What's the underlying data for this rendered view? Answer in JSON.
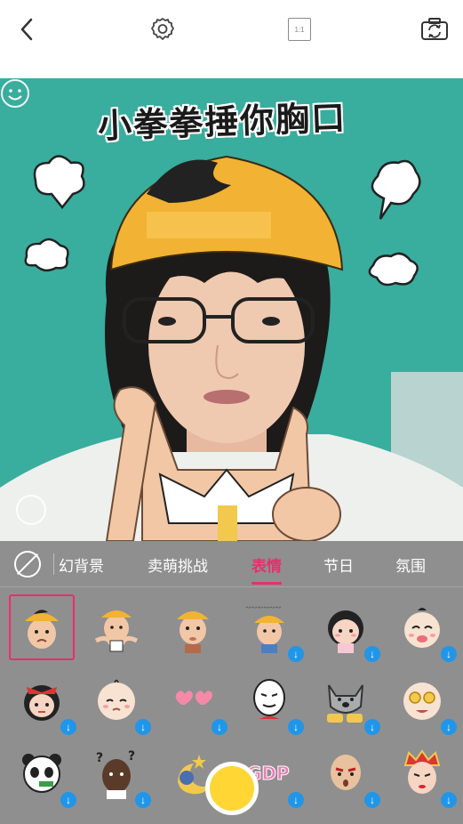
{
  "topbar": {
    "back_icon": "chevron-left-icon",
    "settings_icon": "gear-icon",
    "ratio_label": "1:1",
    "switch_icon": "camera-switch-icon"
  },
  "preview": {
    "caption": "小拳拳捶你胸口"
  },
  "tabs": [
    {
      "label": "幻背景"
    },
    {
      "label": "卖萌挑战"
    },
    {
      "label": "表情"
    },
    {
      "label": "节日"
    },
    {
      "label": "氛围"
    }
  ],
  "active_tab": "表情",
  "stickers": {
    "row1": [
      "sticker-cap-boy-sad",
      "sticker-cap-boy-shrug",
      "sticker-cap-boy-pout",
      "sticker-cap-boy-text",
      "sticker-girl-sad",
      "sticker-baby-cry"
    ],
    "row2": [
      "sticker-girl-red-bow",
      "sticker-baby-bald",
      "sticker-hearts",
      "sticker-meme-face",
      "sticker-dog",
      "sticker-money-eyes"
    ],
    "row3": [
      "sticker-panda",
      "sticker-question-man",
      "sticker-moon",
      "sticker-gdp",
      "sticker-bald-man",
      "sticker-opera"
    ],
    "selected_index": 0
  },
  "colors": {
    "accent": "#e5306c",
    "panel_bg": "#8f8f8f",
    "download_badge": "#2196e8",
    "shutter": "#ffd633"
  }
}
